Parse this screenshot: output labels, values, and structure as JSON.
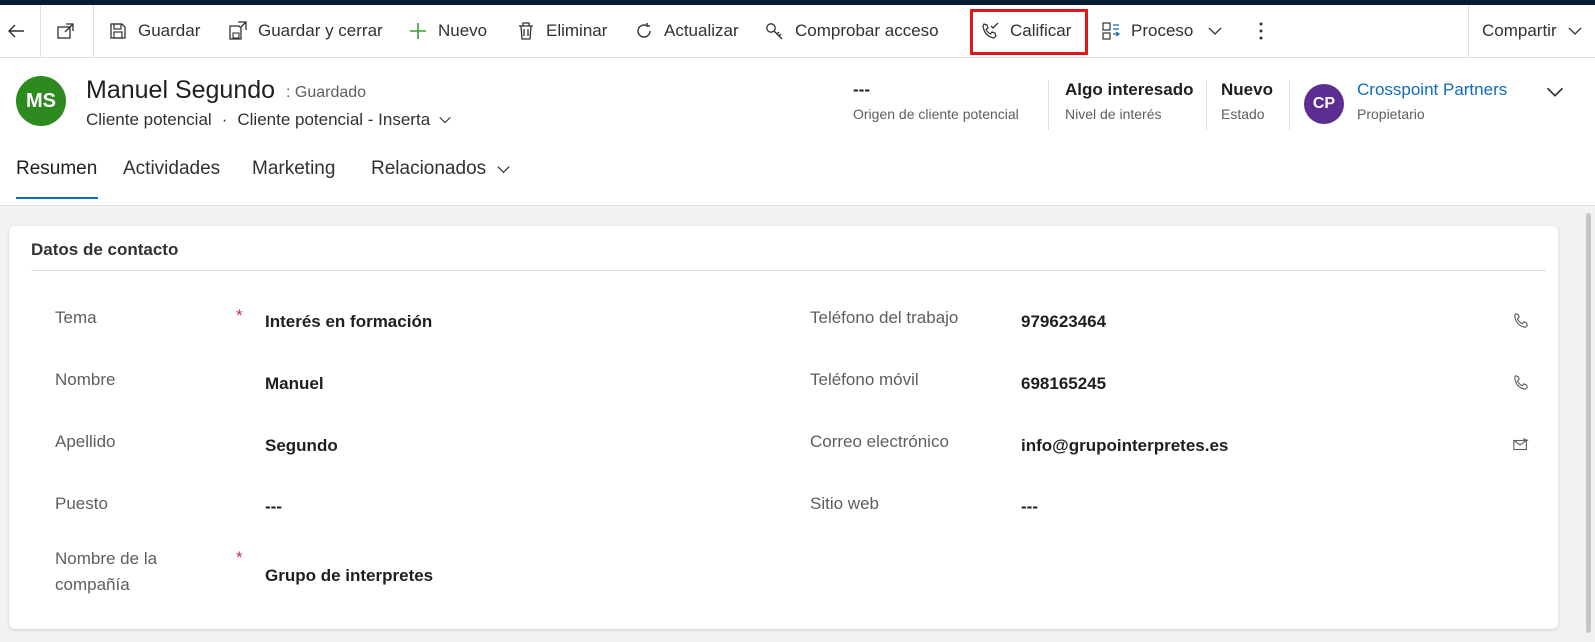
{
  "toolbar": {
    "save": "Guardar",
    "save_close": "Guardar y cerrar",
    "new": "Nuevo",
    "delete": "Eliminar",
    "refresh": "Actualizar",
    "check_access": "Comprobar acceso",
    "qualify": "Calificar",
    "process": "Proceso",
    "share": "Compartir"
  },
  "record": {
    "initials": "MS",
    "name": "Manuel Segundo",
    "saved_status": ": Guardado",
    "entity": "Cliente potencial",
    "separator": "·",
    "form": "Cliente potencial - Inserta"
  },
  "header_fields": {
    "lead_source": {
      "value": "---",
      "label": "Origen de cliente potencial"
    },
    "interest": {
      "value": "Algo interesado",
      "label": "Nivel de interés"
    },
    "status": {
      "value": "Nuevo",
      "label": "Estado"
    },
    "owner": {
      "initials": "CP",
      "value": "Crosspoint Partners",
      "label": "Propietario"
    }
  },
  "tabs": [
    {
      "label": "Resumen"
    },
    {
      "label": "Actividades"
    },
    {
      "label": "Marketing"
    },
    {
      "label": "Relacionados"
    }
  ],
  "section": {
    "title": "Datos de contacto",
    "fields": {
      "topic": {
        "label": "Tema",
        "value": "Interés en formación"
      },
      "first_name": {
        "label": "Nombre",
        "value": "Manuel"
      },
      "last_name": {
        "label": "Apellido",
        "value": "Segundo"
      },
      "job_title": {
        "label": "Puesto",
        "value": "---"
      },
      "company": {
        "label_line1": "Nombre de la",
        "label_line2": "compañía",
        "value": "Grupo de interpretes"
      },
      "work_phone": {
        "label": "Teléfono del trabajo",
        "value": "979623464"
      },
      "mobile_phone": {
        "label": "Teléfono móvil",
        "value": "698165245"
      },
      "email": {
        "label": "Correo electrónico",
        "value": "info@grupointerpretes.es"
      },
      "website": {
        "label": "Sitio web",
        "value": "---"
      }
    },
    "required_mark": "*"
  },
  "colors": {
    "avatar_ms": "#2d8a1f",
    "avatar_cp": "#5c2e91",
    "owner_link": "#0f6cbd",
    "highlight": "#e0161b",
    "tab_underline": "#0f6cbd"
  },
  "icons": [
    "back-arrow-icon",
    "open-window-icon",
    "save-icon",
    "save-close-icon",
    "plus-icon",
    "trash-icon",
    "refresh-icon",
    "key-icon",
    "qualify-phone-check-icon",
    "process-icon",
    "chevron-down-icon",
    "more-vertical-icon",
    "phone-icon",
    "email-icon"
  ]
}
